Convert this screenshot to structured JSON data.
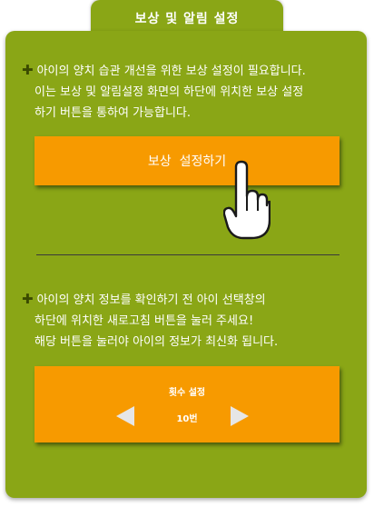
{
  "tab": {
    "title": "보상 및 알림 설정"
  },
  "section1": {
    "bullet": "✚",
    "lines": [
      "아이의 양치 습관 개선을 위한 보상 설정이 필요합니다.",
      "이는 보상 및 알림설정 화면의 하단에 위치한 보상 설정",
      "하기 버튼을 통하여 가능합니다."
    ],
    "button_label": "보상  설정하기"
  },
  "section2": {
    "bullet": "✚",
    "lines": [
      "아이의 양치 정보를 확인하기 전 아이 선택창의",
      "하단에 위치한 새로고침 버튼을 눌러 주세요!",
      "해당 버튼을 눌러야 아이의 정보가 최신화 됩니다."
    ]
  },
  "count_setting": {
    "title": "횟수 설정",
    "value": "10번"
  },
  "icons": {
    "bullet": "plus-icon",
    "pointer": "hand-pointer-icon",
    "decrease": "triangle-left-icon",
    "increase": "triangle-right-icon"
  },
  "colors": {
    "panel": "#8aa616",
    "button": "#f79a00",
    "text": "#ffffff",
    "bullet": "#3a4a00",
    "arrow": "#e6e6e6"
  }
}
